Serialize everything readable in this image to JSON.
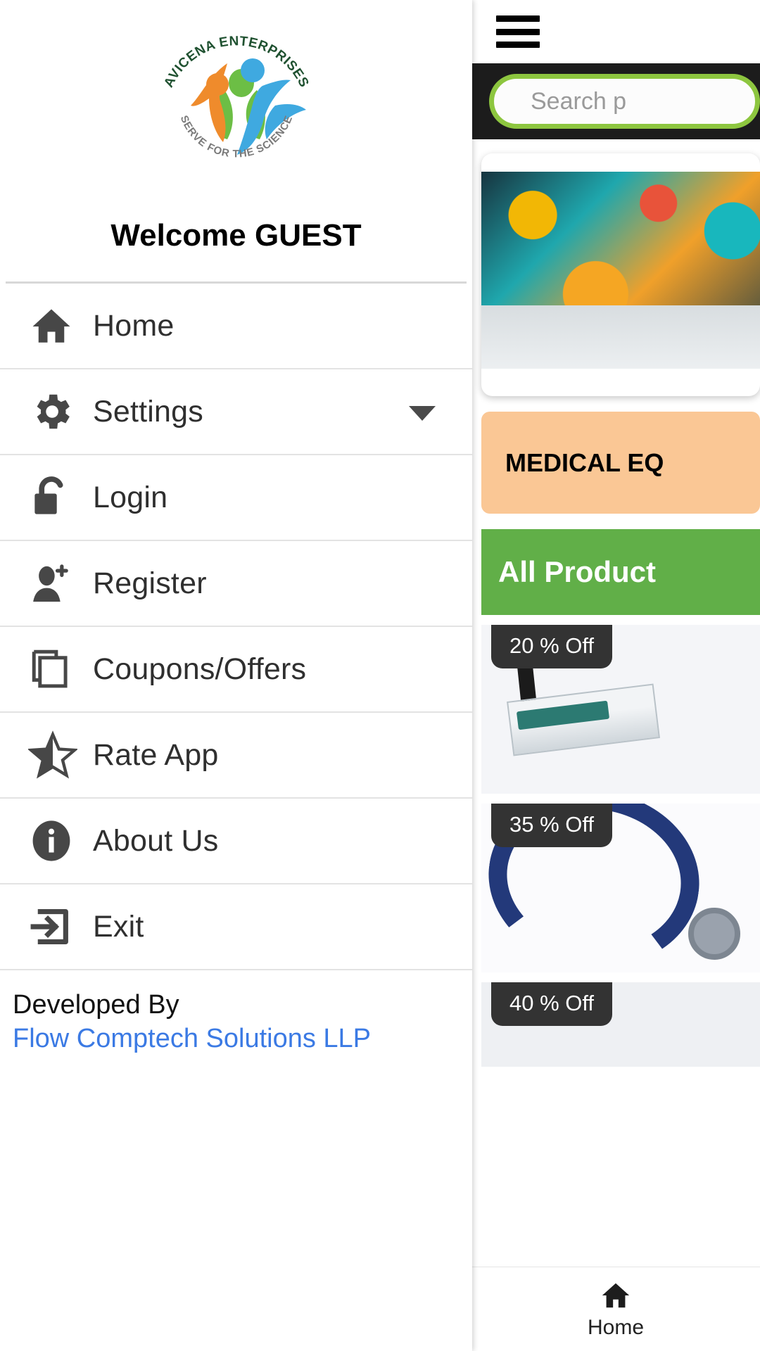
{
  "drawer": {
    "logo": {
      "top_text": "AVICENA ENTERPRISES",
      "bottom_text": "SERVE FOR THE SCIENCE",
      "top_color": "#1f5130",
      "bottom_color": "#7a7a7a",
      "figure_colors": [
        "#ef8b2c",
        "#3fa9e0",
        "#6cbe45"
      ]
    },
    "welcome": "Welcome GUEST",
    "items": [
      {
        "label": "Home",
        "icon": "home-icon",
        "has_chevron": false
      },
      {
        "label": "Settings",
        "icon": "gear-icon",
        "has_chevron": true
      },
      {
        "label": "Login",
        "icon": "unlock-icon",
        "has_chevron": false
      },
      {
        "label": "Register",
        "icon": "person-add-icon",
        "has_chevron": false
      },
      {
        "label": "Coupons/Offers",
        "icon": "copy-layers-icon",
        "has_chevron": false
      },
      {
        "label": "Rate App",
        "icon": "half-star-icon",
        "has_chevron": false
      },
      {
        "label": "About Us",
        "icon": "info-circle-icon",
        "has_chevron": false
      },
      {
        "label": "Exit",
        "icon": "exit-arrow-icon",
        "has_chevron": false
      }
    ],
    "footer": {
      "developed_by": "Developed By",
      "company": "Flow Comptech Solutions LLP",
      "company_color": "#3b7ae4"
    }
  },
  "content": {
    "menu_icon": "hamburger-menu-icon",
    "search": {
      "placeholder": "Search p",
      "border_color": "#8dc63f",
      "bar_background": "#1c1c1c"
    },
    "banner_medical": {
      "text": "MEDICAL EQ",
      "background": "#fac795"
    },
    "all_products": {
      "text": "All Product",
      "background": "#61af48"
    },
    "products": [
      {
        "badge": "20 % Off",
        "image": "blood-pressure-monitor-image"
      },
      {
        "badge": "35 % Off",
        "image": "stethoscope-image"
      },
      {
        "badge": "40 % Off",
        "image": "product-image"
      }
    ],
    "bottom_nav": [
      {
        "label": "Home",
        "icon": "home-icon"
      }
    ]
  }
}
